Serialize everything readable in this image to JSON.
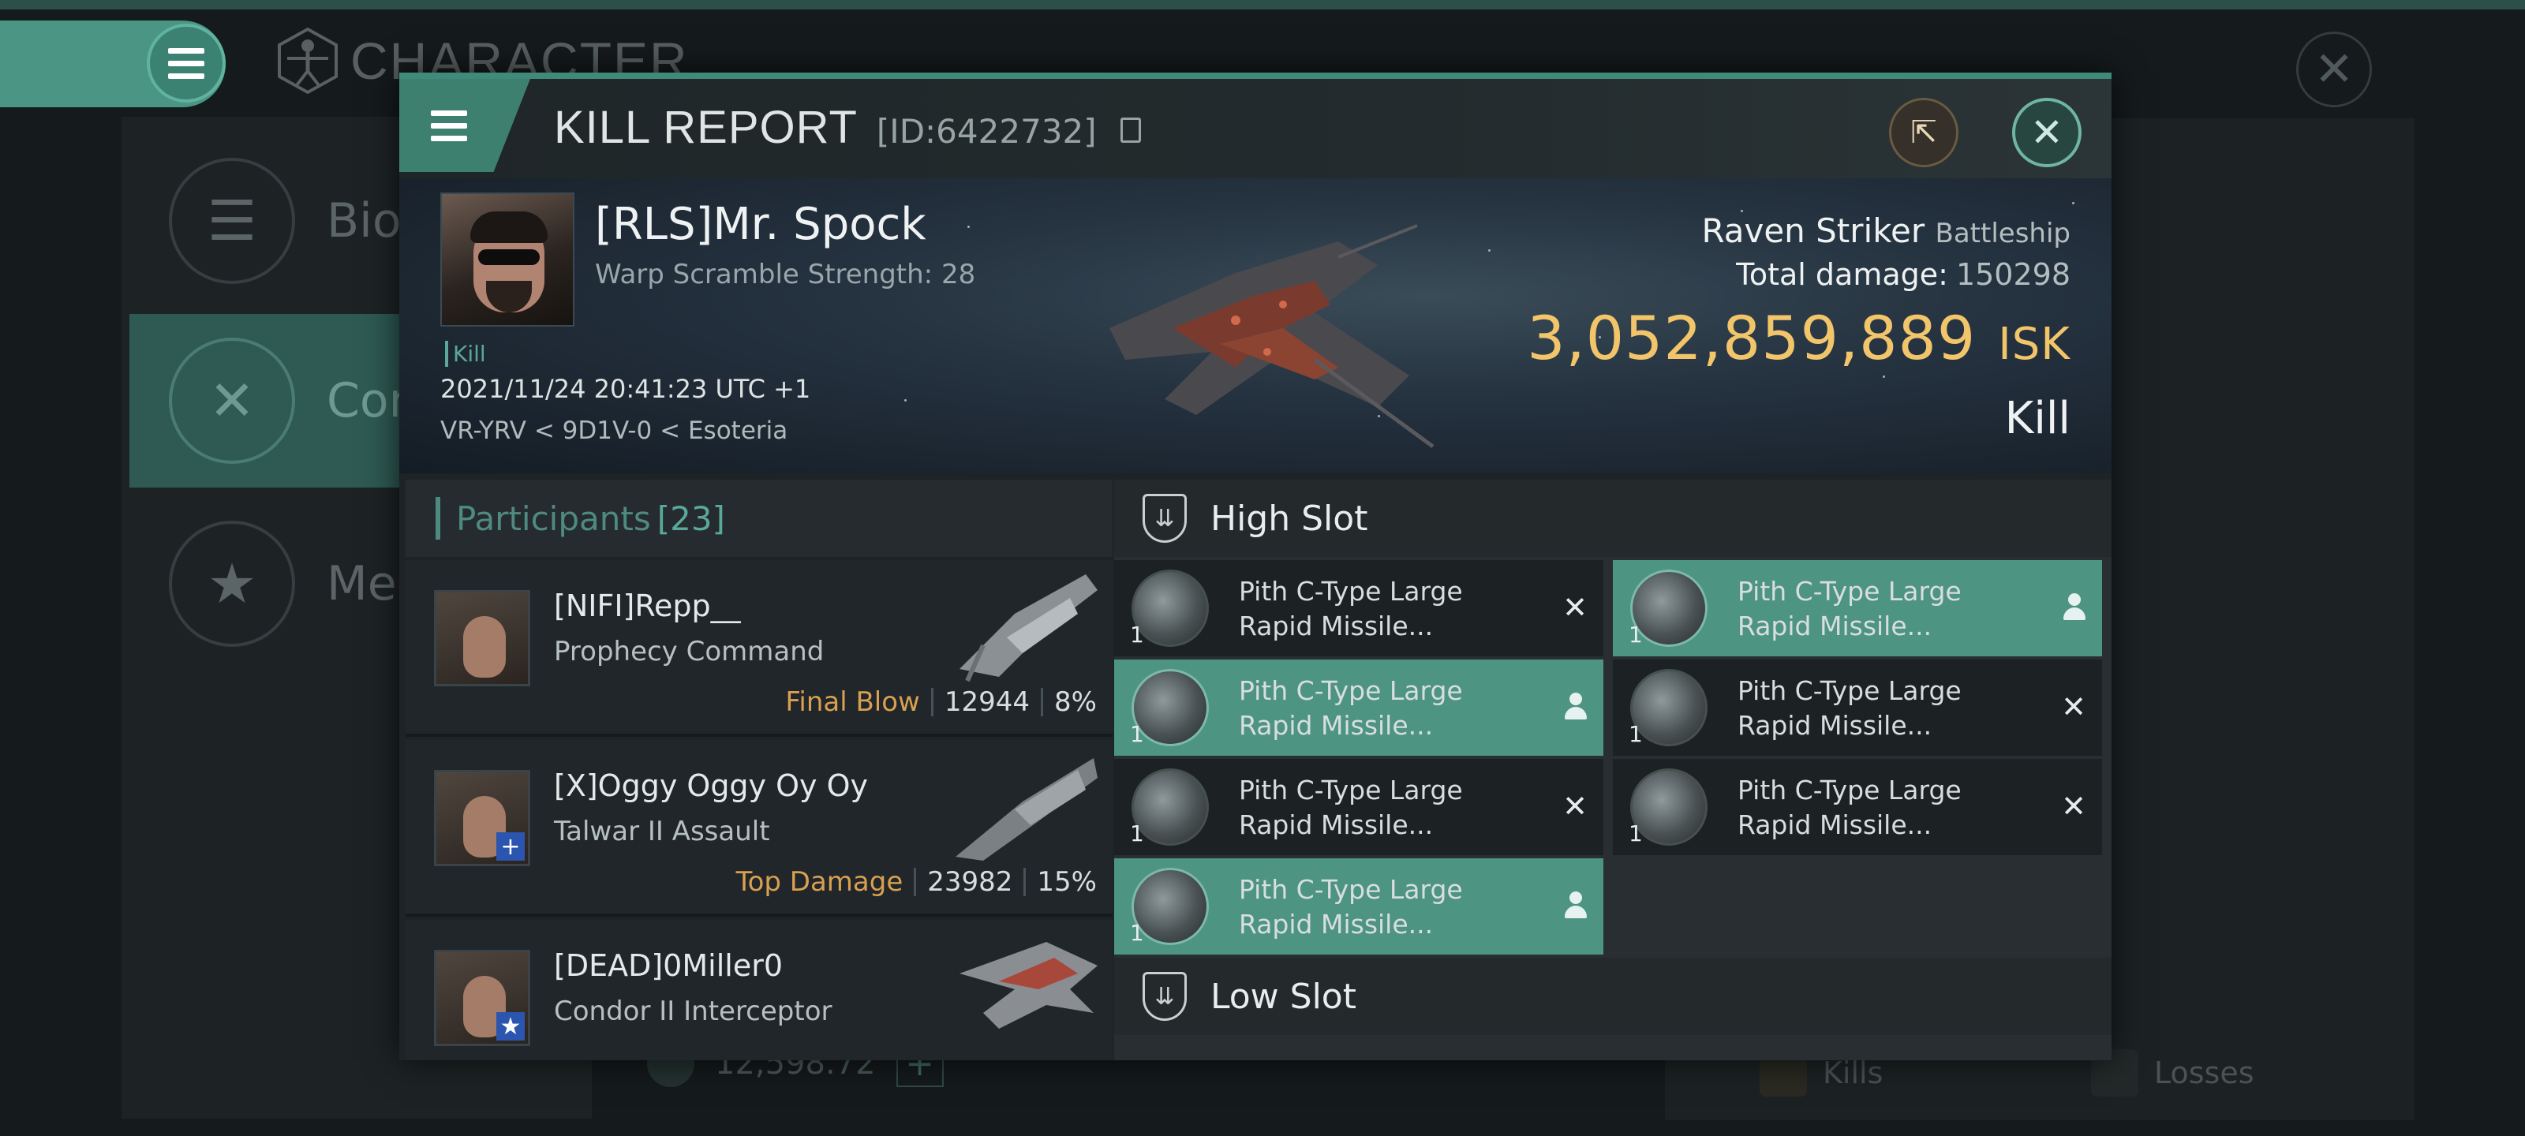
{
  "background": {
    "title": "CHARACTER",
    "menu_items": [
      {
        "label": "Bio",
        "icon": "bars-icon"
      },
      {
        "label": "Comb",
        "icon": "crossed-swords-icon"
      },
      {
        "label": "Meda",
        "icon": "star-badge-icon"
      }
    ],
    "balance": "12,598.72",
    "kills_label": "Kills",
    "losses_label": "Losses"
  },
  "modal": {
    "title": "KILL REPORT",
    "id_text": "[ID:6422732]",
    "share_icon": "share-icon",
    "close_icon": "close-icon"
  },
  "victim": {
    "name": "[RLS]Mr. Spock",
    "subtitle": "Warp Scramble Strength: 28",
    "tag": "Kill",
    "datetime": "2021/11/24 20:41:23 UTC +1",
    "location": "VR-YRV < 9D1V-0 < Esoteria",
    "ship": "Raven Striker",
    "ship_class": "Battleship",
    "total_damage_label": "Total damage:",
    "total_damage": "150298",
    "isk_value": "3,052,859,889",
    "isk_unit": "ISK",
    "result": "Kill"
  },
  "participants": {
    "label": "Participants",
    "count": "[23]",
    "rows": [
      {
        "name": "[NIFI]Repp__",
        "ship": "Prophecy Command",
        "tag": "Final Blow",
        "damage": "12944",
        "percent": "8%"
      },
      {
        "name": "[X]Oggy Oggy Oy Oy",
        "ship": "Talwar II Assault",
        "tag": "Top Damage",
        "damage": "23982",
        "percent": "15%"
      },
      {
        "name": "[DEAD]0Miller0",
        "ship": "Condor II Interceptor",
        "tag": "",
        "damage": "",
        "percent": ""
      }
    ]
  },
  "fittings": {
    "high_slot_label": "High Slot",
    "low_slot_label": "Low Slot",
    "high_slot": [
      {
        "name_line1": "Pith C-Type Large",
        "name_line2": "Rapid Missile...",
        "qty": "1",
        "state": "destroyed"
      },
      {
        "name_line1": "Pith C-Type Large",
        "name_line2": "Rapid Missile...",
        "qty": "1",
        "state": "dropped"
      },
      {
        "name_line1": "Pith C-Type Large",
        "name_line2": "Rapid Missile...",
        "qty": "1",
        "state": "dropped"
      },
      {
        "name_line1": "Pith C-Type Large",
        "name_line2": "Rapid Missile...",
        "qty": "1",
        "state": "destroyed"
      },
      {
        "name_line1": "Pith C-Type Large",
        "name_line2": "Rapid Missile...",
        "qty": "1",
        "state": "destroyed"
      },
      {
        "name_line1": "Pith C-Type Large",
        "name_line2": "Rapid Missile...",
        "qty": "1",
        "state": "destroyed"
      },
      {
        "name_line1": "Pith C-Type Large",
        "name_line2": "Rapid Missile...",
        "qty": "1",
        "state": "dropped"
      }
    ]
  },
  "colors": {
    "accent": "#4d9482",
    "isk": "#f2c56a",
    "tag": "#d8a050"
  }
}
